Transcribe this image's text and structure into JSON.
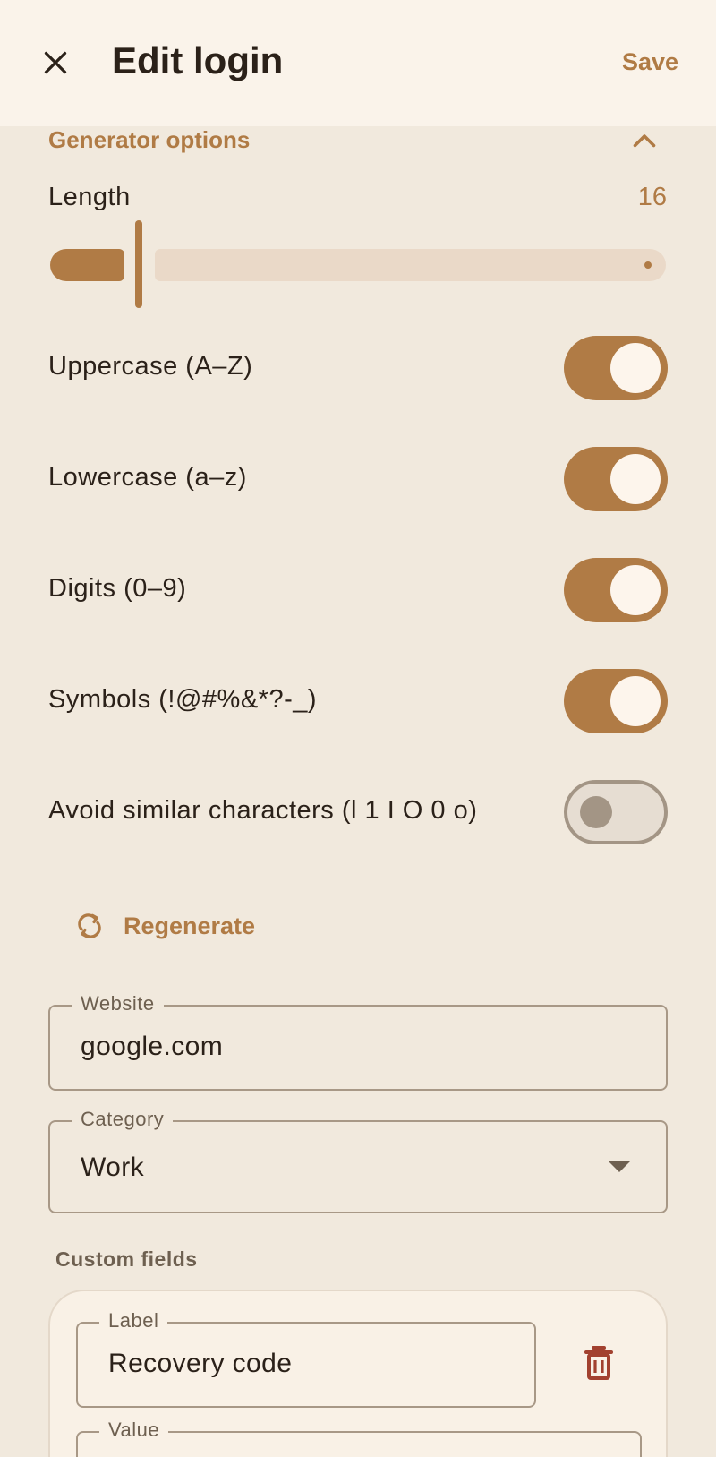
{
  "header": {
    "title": "Edit login",
    "save_label": "Save"
  },
  "generator": {
    "section_title": "Generator options",
    "length_label": "Length",
    "length_value": "16",
    "slider_fraction": 0.15,
    "options": [
      {
        "label": "Uppercase (A–Z)",
        "enabled": true
      },
      {
        "label": "Lowercase (a–z)",
        "enabled": true
      },
      {
        "label": "Digits (0–9)",
        "enabled": true
      },
      {
        "label": "Symbols (!@#%&*?-_)",
        "enabled": true
      },
      {
        "label": "Avoid similar characters (l 1 I O 0 o)",
        "enabled": false
      }
    ],
    "regenerate_label": "Regenerate"
  },
  "website": {
    "label": "Website",
    "value": "google.com"
  },
  "category": {
    "label": "Category",
    "value": "Work"
  },
  "custom_fields": {
    "title": "Custom fields",
    "label_field_label": "Label",
    "label_field_value": "Recovery code",
    "value_field_label": "Value"
  },
  "colors": {
    "accent": "#b07b45",
    "background": "#f1e9dd",
    "topbar": "#faf3ea",
    "delete": "#a2412f"
  }
}
